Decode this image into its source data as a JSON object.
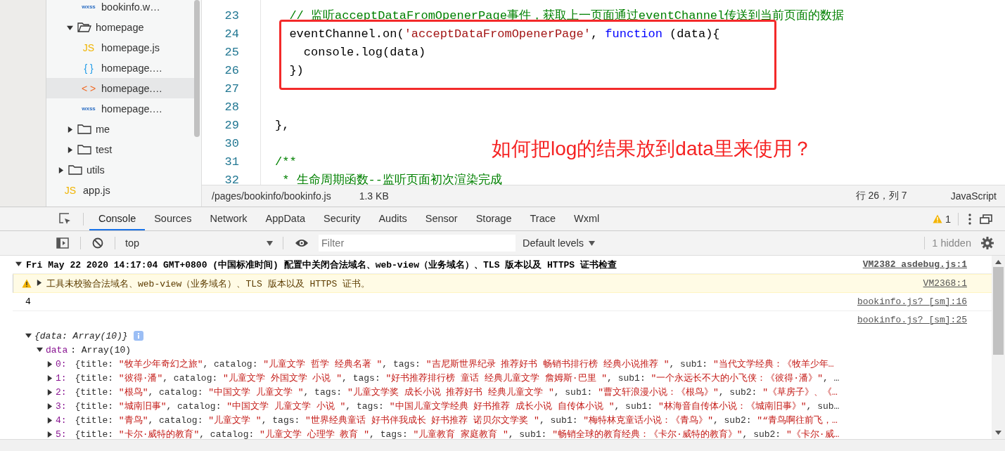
{
  "file_tree": [
    {
      "children": [
        {
          "children": [
            {
              "label": "bookinfo.w…",
              "kind": "wxss",
              "badge": "wxss",
              "selected": false
            }
          ]
        },
        {
          "label": "homepage",
          "kind": "folder",
          "expanded": true,
          "children": [
            {
              "label": "homepage.js",
              "kind": "js",
              "badge": "JS",
              "selected": false
            },
            {
              "label": "homepage.…",
              "kind": "json",
              "badge": "{ }",
              "selected": false
            },
            {
              "label": "homepage.…",
              "kind": "wxml",
              "badge": "< >",
              "selected": true
            },
            {
              "label": "homepage.…",
              "kind": "wxss",
              "badge": "wxss",
              "selected": false
            }
          ]
        },
        {
          "label": "me",
          "kind": "folder",
          "expanded": false
        },
        {
          "label": "test",
          "kind": "folder",
          "expanded": false
        }
      ]
    },
    {
      "label": "utils",
      "kind": "folder",
      "expanded": false
    },
    {
      "label": "app.js",
      "kind": "js",
      "badge": "JS",
      "selected": false
    }
  ],
  "editor": {
    "lines": [
      {
        "number": "23",
        "tokens": [
          {
            "kind": "comment",
            "text": "  // 监听acceptDataFromOpenerPage事件，获取上一页面通过eventChannel传送到当前页面的数据"
          }
        ]
      },
      {
        "number": "24",
        "tokens": [
          {
            "kind": "plain",
            "text": "  eventChannel.on("
          },
          {
            "kind": "string",
            "text": "'acceptDataFromOpenerPage'"
          },
          {
            "kind": "plain",
            "text": ", "
          },
          {
            "kind": "keyword",
            "text": "function"
          },
          {
            "kind": "plain",
            "text": " (data){"
          }
        ]
      },
      {
        "number": "25",
        "tokens": [
          {
            "kind": "plain",
            "text": "    console.log(data)"
          }
        ]
      },
      {
        "number": "26",
        "tokens": [
          {
            "kind": "plain",
            "text": "  })"
          }
        ]
      },
      {
        "number": "27"
      },
      {
        "number": "28"
      },
      {
        "number": "29",
        "tokens": [
          {
            "kind": "plain",
            "text": "},"
          }
        ]
      },
      {
        "number": "30"
      },
      {
        "number": "31",
        "tokens": [
          {
            "kind": "comment",
            "text": "/**"
          }
        ]
      },
      {
        "number": "32",
        "tokens": [
          {
            "kind": "comment",
            "text": " * 生命周期函数--监听页面初次渲染完成"
          }
        ]
      }
    ],
    "annotation": "如何把log的结果放到data里来使用？"
  },
  "status_bar": {
    "path": "/pages/bookinfo/bookinfo.js",
    "size": "1.3 KB",
    "cursor": "行 26，列 7",
    "language": "JavaScript"
  },
  "devtools": {
    "tabs": [
      {
        "label": "Console",
        "selected": true
      },
      {
        "label": "Sources",
        "selected": false
      },
      {
        "label": "Network",
        "selected": false
      },
      {
        "label": "AppData",
        "selected": false
      },
      {
        "label": "Security",
        "selected": false
      },
      {
        "label": "Audits",
        "selected": false
      },
      {
        "label": "Sensor",
        "selected": false
      },
      {
        "label": "Storage",
        "selected": false
      },
      {
        "label": "Trace",
        "selected": false
      },
      {
        "label": "Wxml",
        "selected": false
      }
    ],
    "warning_count": "1",
    "context": "top",
    "filter": {
      "placeholder": "Filter"
    },
    "levels": "Default levels",
    "hidden": "1 hidden"
  },
  "console": {
    "messages": [
      {
        "kind": "group",
        "expanded": true,
        "text": "Fri May 22 2020 14:17:04 GMT+0800 (中国标准时间) 配置中关闭合法域名、web-view（业务域名）、TLS 版本以及 HTTPS 证书检查",
        "source": "VM2382 asdebug.js:1"
      },
      {
        "kind": "warning",
        "expanded": false,
        "text": "工具未校验合法域名、web-view（业务域名）、TLS 版本以及 HTTPS 证书。",
        "source": "VM2368:1"
      },
      {
        "kind": "log",
        "text": "4",
        "source": "bookinfo.js? [sm]:16"
      },
      {
        "kind": "object",
        "source": "bookinfo.js? [sm]:25",
        "expanded": true,
        "summary": "{data: Array(10)}",
        "property": {
          "key": "data",
          "value": ": Array(10)",
          "expanded": true
        },
        "rows": [
          {
            "index": "0:",
            "fields": [
              {
                "key": " {title: ",
                "value": "\"牧羊少年奇幻之旅\""
              },
              {
                "key": ", catalog: ",
                "value": "\"儿童文学 哲学 经典名著 \""
              },
              {
                "key": ", tags: ",
                "value": "\"吉尼斯世界纪录 推荐好书 畅销书排行榜 经典小说推荐 \""
              },
              {
                "key": ", sub1: ",
                "value": "\"当代文学经典：《牧羊少年…"
              }
            ]
          },
          {
            "index": "1:",
            "fields": [
              {
                "key": " {title: ",
                "value": "\"彼得·潘\""
              },
              {
                "key": ", catalog: ",
                "value": "\"儿童文学 外国文学 小说 \""
              },
              {
                "key": ", tags: ",
                "value": "\"好书推荐排行榜 童话 经典儿童文学 詹姆斯·巴里 \""
              },
              {
                "key": ", sub1: ",
                "value": "\"一个永远长不大的小飞侠：《彼得·潘》\""
              }
            ],
            "tail": ", …"
          },
          {
            "index": "2:",
            "fields": [
              {
                "key": " {title: ",
                "value": "\"根鸟\""
              },
              {
                "key": ", catalog: ",
                "value": "\"中国文学 儿童文学 \""
              },
              {
                "key": ", tags: ",
                "value": "\"儿童文学奖 成长小说 推荐好书 经典儿童文学 \""
              },
              {
                "key": ", sub1: ",
                "value": "\"曹文轩浪漫小说：《根鸟》\""
              },
              {
                "key": ", sub2: ",
                "value": "\"《草房子》、《…"
              }
            ]
          },
          {
            "index": "3:",
            "fields": [
              {
                "key": " {title: ",
                "value": "\"城南旧事\""
              },
              {
                "key": ", catalog: ",
                "value": "\"中国文学 儿童文学 小说 \""
              },
              {
                "key": ", tags: ",
                "value": "\"中国儿童文学经典 好书推荐 成长小说 自传体小说 \""
              },
              {
                "key": ", sub1: ",
                "value": "\"林海音自传体小说：《城南旧事》\""
              }
            ],
            "tail": ", sub…"
          },
          {
            "index": "4:",
            "fields": [
              {
                "key": " {title: ",
                "value": "\"青鸟\""
              },
              {
                "key": ", catalog: ",
                "value": "\"儿童文学 \""
              },
              {
                "key": ", tags: ",
                "value": "\"世界经典童话 好书伴我成长 好书推荐 诺贝尔文学奖 \""
              },
              {
                "key": ", sub1: ",
                "value": "\"梅特林克童话小说：《青鸟》\""
              },
              {
                "key": ", sub2: ",
                "value": "\"“青鸟啊往前飞，…"
              }
            ]
          },
          {
            "index": "5:",
            "fields": [
              {
                "key": " {title: ",
                "value": "\"卡尔·威特的教育\""
              },
              {
                "key": ", catalog: ",
                "value": "\"儿童文学 心理学 教育 \""
              },
              {
                "key": ", tags: ",
                "value": "\"儿童教育 家庭教育 \""
              },
              {
                "key": ", sub1: ",
                "value": "\"畅销全球的教育经典：《卡尔·威特的教育》\""
              },
              {
                "key": ", sub2: ",
                "value": "\"《卡尔·威…"
              }
            ]
          }
        ]
      }
    ]
  }
}
